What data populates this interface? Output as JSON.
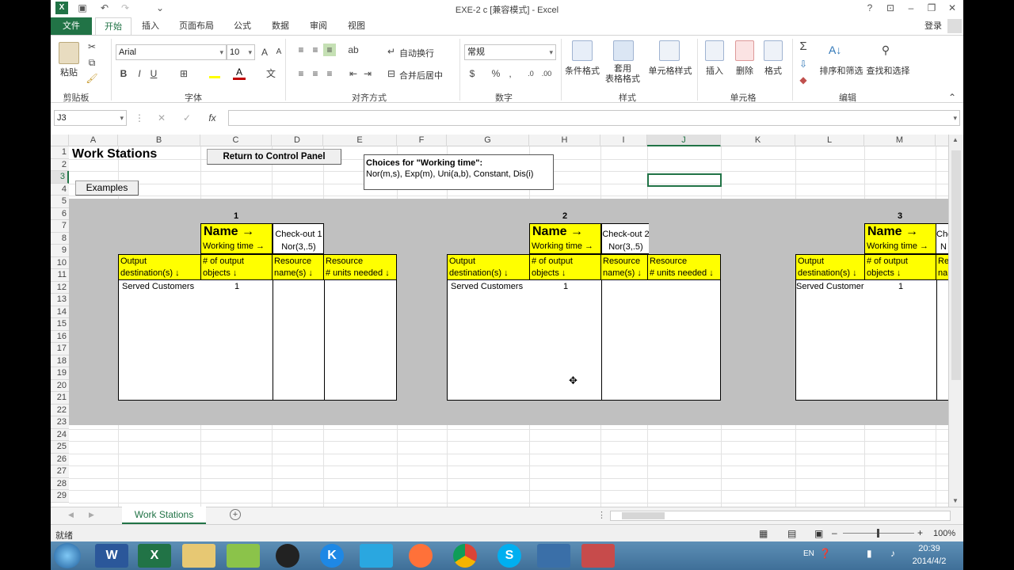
{
  "window": {
    "title": "EXE-2 c  [兼容模式] - Excel",
    "help": "?",
    "user": "登录"
  },
  "ribbon_tabs": [
    "文件",
    "开始",
    "插入",
    "页面布局",
    "公式",
    "数据",
    "审阅",
    "视图"
  ],
  "clipboard": {
    "paste": "粘贴",
    "group": "剪贴板"
  },
  "font": {
    "name": "Arial",
    "size": "10",
    "bold": "B",
    "italic": "I",
    "underline": "U",
    "group": "字体"
  },
  "alignment": {
    "wrap": "自动换行",
    "merge": "合并后居中",
    "group": "对齐方式"
  },
  "number": {
    "format": "常规",
    "percent": "%",
    "comma": ",",
    "group": "数字"
  },
  "styles": {
    "cond": "条件格式",
    "table": "套用\n表格格式",
    "cell": "单元格样式",
    "group": "样式"
  },
  "cells": {
    "insert": "插入",
    "delete": "删除",
    "format": "格式",
    "group": "单元格"
  },
  "editing": {
    "sort": "排序和筛选",
    "find": "查找和选择",
    "group": "编辑"
  },
  "formula_bar": {
    "name_box": "J3",
    "cancel": "✕",
    "enter": "✓",
    "fx": "fx",
    "value": ""
  },
  "columns": [
    "A",
    "B",
    "C",
    "D",
    "E",
    "F",
    "G",
    "H",
    "I",
    "J",
    "K",
    "L",
    "M"
  ],
  "rows": [
    "1",
    "2",
    "3",
    "4",
    "5",
    "6",
    "7",
    "8",
    "9",
    "10",
    "11",
    "12",
    "13",
    "14",
    "15",
    "16",
    "17",
    "18",
    "19",
    "20",
    "21",
    "22",
    "23",
    "24",
    "25",
    "26",
    "27",
    "28",
    "29"
  ],
  "sheet": {
    "title": "Work Stations",
    "return_button": "Return to Control Panel",
    "examples_button": "Examples",
    "choices_title": "Choices for \"Working time\":",
    "choices_text": "Nor(m,s), Exp(m), Uni(a,b), Constant, Dis(i)",
    "stations": [
      {
        "num": "1",
        "name_label": "Name →",
        "name": "Check-out 1",
        "wt_label": "Working time →",
        "wt": "Nor(3,.5)",
        "out_h1": "Output",
        "out_h2": "destination(s) ↓",
        "num_h1": "# of output",
        "num_h2": "objects ↓",
        "res_h1": "Resource",
        "res_h2": "name(s) ↓",
        "units_h1": "Resource",
        "units_h2": "# units needed ↓",
        "out_val": "Served Customers",
        "num_val": "1"
      },
      {
        "num": "2",
        "name_label": "Name →",
        "name": "Check-out 2",
        "wt_label": "Working time →",
        "wt": "Nor(3,.5)",
        "out_h1": "Output",
        "out_h2": "destination(s) ↓",
        "num_h1": "# of output",
        "num_h2": "objects ↓",
        "res_h1": "Resource",
        "res_h2": "name(s) ↓",
        "units_h1": "Resource",
        "units_h2": "# units needed ↓",
        "out_val": "Served Customers",
        "num_val": "1"
      },
      {
        "num": "3",
        "name_label": "Name →",
        "name": "Che",
        "wt_label": "Working time →",
        "wt": "N",
        "out_h1": "Output",
        "out_h2": "destination(s) ↓",
        "num_h1": "# of output",
        "num_h2": "objects ↓",
        "res_h1": "Re",
        "res_h2": "na",
        "out_val": "Served Customer",
        "num_val": "1"
      }
    ]
  },
  "sheet_tab": "Work Stations",
  "status": {
    "ready": "就绪",
    "zoom": "100%"
  },
  "clock": {
    "time": "20:39",
    "date": "2014/4/2",
    "lang": "EN"
  }
}
